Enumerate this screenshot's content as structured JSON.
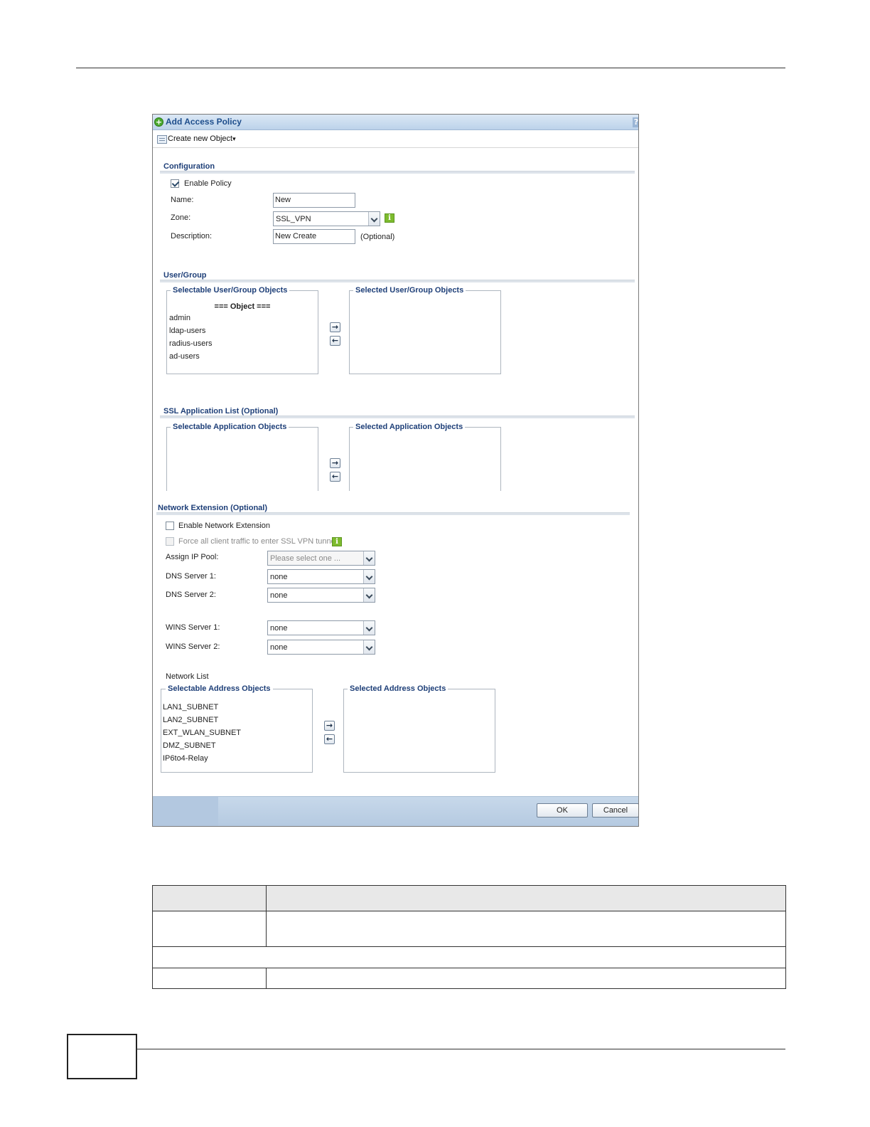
{
  "dialog": {
    "title": "Add Access Policy",
    "help": "?",
    "toolbar": {
      "create_label": "Create new Object"
    },
    "configuration": {
      "heading": "Configuration",
      "enable_policy": {
        "label": "Enable Policy",
        "checked": true
      },
      "name": {
        "label": "Name:",
        "value": "New"
      },
      "zone": {
        "label": "Zone:",
        "value": "SSL_VPN"
      },
      "description": {
        "label": "Description:",
        "value": "New Create",
        "note": "(Optional)"
      }
    },
    "user_group": {
      "heading": "User/Group",
      "selectable_legend": "Selectable User/Group Objects",
      "selected_legend": "Selected User/Group Objects",
      "object_header": "=== Object ===",
      "items": [
        "admin",
        "ldap-users",
        "radius-users",
        "ad-users"
      ]
    },
    "ssl_app": {
      "heading": "SSL Application List (Optional)",
      "selectable_legend": "Selectable Application Objects",
      "selected_legend": "Selected Application Objects"
    },
    "network_extension": {
      "heading": "Network Extension (Optional)",
      "enable_label": "Enable Network Extension",
      "force_label": "Force all client traffic to enter SSL VPN tunnel",
      "assign_ip_pool": {
        "label": "Assign IP Pool:",
        "value": "Please select one ..."
      },
      "dns1": {
        "label": "DNS Server 1:",
        "value": "none"
      },
      "dns2": {
        "label": "DNS Server 2:",
        "value": "none"
      },
      "wins1": {
        "label": "WINS Server 1:",
        "value": "none"
      },
      "wins2": {
        "label": "WINS Server 2:",
        "value": "none"
      },
      "network_list_label": "Network List",
      "selectable_legend": "Selectable Address Objects",
      "selected_legend": "Selected Address Objects",
      "items": [
        "LAN1_SUBNET",
        "LAN2_SUBNET",
        "EXT_WLAN_SUBNET",
        "DMZ_SUBNET",
        "IP6to4-Relay"
      ]
    },
    "buttons": {
      "ok": "OK",
      "cancel": "Cancel"
    },
    "arrows": {
      "add": "→",
      "remove": "←"
    },
    "info_glyph": "i",
    "add_glyph": "+",
    "dropdown_caret": "▾"
  }
}
